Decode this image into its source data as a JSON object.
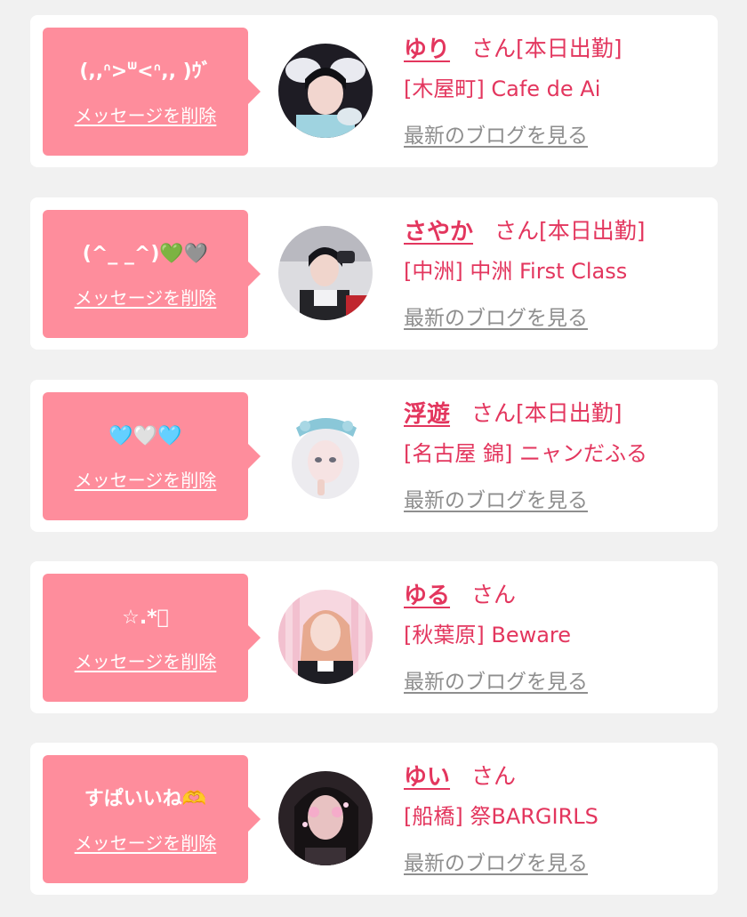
{
  "delete_label": "メッセージを削除",
  "blog_label": "最新のブログを見る",
  "colors": {
    "accent": "#e3365e",
    "bubble": "#fe8d9c",
    "link_gray": "#8e8e8e",
    "background": "#f1f1f1"
  },
  "messages": [
    {
      "message": "(,,ᐢ>ᐜ<ᐢ,, )ｳﾞ",
      "name": "ゆり",
      "suffix": "さん[本日出勤]",
      "shop": "[木屋町] Cafe de Ai"
    },
    {
      "message": "(^_ _^)💚🩶",
      "name": "さやか",
      "suffix": "さん[本日出勤]",
      "shop": "[中洲] 中洲 First Class"
    },
    {
      "message": "🩵🤍🩵",
      "name": "浮遊",
      "suffix": "さん[本日出勤]",
      "shop": "[名古屋 錦] ニャンだふる"
    },
    {
      "message": "☆.*ﾟ",
      "name": "ゆる",
      "suffix": "さん",
      "shop": "[秋葉原] Beware"
    },
    {
      "message": "すぱいいね🫶",
      "name": "ゆい",
      "suffix": "さん",
      "shop": "[船橋] 祭BARGIRLS"
    }
  ]
}
